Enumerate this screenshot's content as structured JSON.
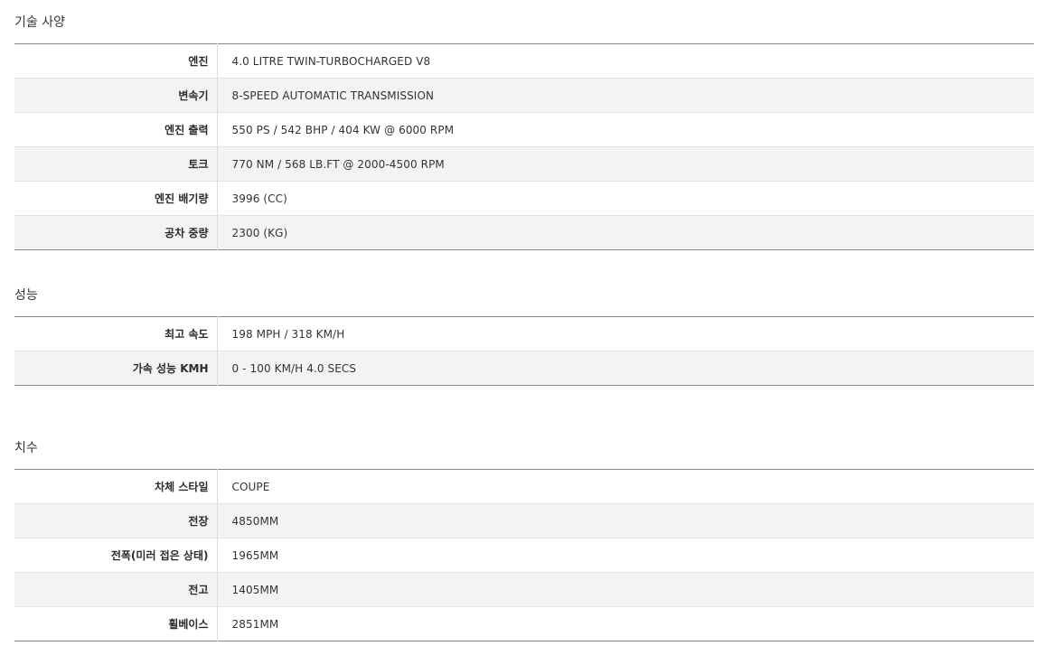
{
  "sections": [
    {
      "title": "기술 사양",
      "rows": [
        {
          "label": "엔진",
          "value": "4.0 LITRE TWIN-TURBOCHARGED V8"
        },
        {
          "label": "변속기",
          "value": "8-SPEED AUTOMATIC TRANSMISSION"
        },
        {
          "label": "엔진 출력",
          "value": "550 PS / 542 BHP / 404 KW @ 6000 RPM"
        },
        {
          "label": "토크",
          "value": "770 NM / 568 LB.FT @ 2000-4500 RPM"
        },
        {
          "label": "엔진 배기량",
          "value": "3996 (CC)"
        },
        {
          "label": "공차 중량",
          "value": "2300 (KG)"
        }
      ]
    },
    {
      "title": "성능",
      "rows": [
        {
          "label": "최고 속도",
          "value": "198 MPH / 318 KM/H"
        },
        {
          "label": "가속 성능 KMH",
          "value": "0 - 100 KM/H 4.0 SECS"
        }
      ]
    },
    {
      "title": "치수",
      "rows": [
        {
          "label": "차체 스타일",
          "value": "COUPE"
        },
        {
          "label": "전장",
          "value": "4850MM"
        },
        {
          "label": "전폭(미러 접은 상태)",
          "value": "1965MM"
        },
        {
          "label": "전고",
          "value": "1405MM"
        },
        {
          "label": "휠베이스",
          "value": "2851MM"
        }
      ]
    }
  ]
}
